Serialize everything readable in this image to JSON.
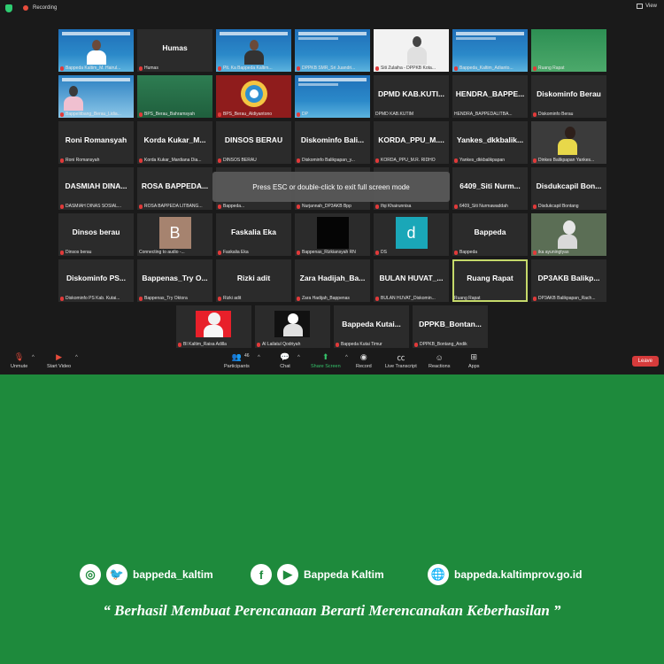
{
  "topbar": {
    "recording": "Recording",
    "view": "View"
  },
  "banner": "Press ESC or double-click to exit full screen mode",
  "tiles": [
    {
      "name": "",
      "cap": "Bappeda Kaltim_M. Hairul..."
    },
    {
      "name": "Humas",
      "cap": "Humas"
    },
    {
      "name": "",
      "cap": "Plt. Ka Bappeda Kaltim..."
    },
    {
      "name": "",
      "cap": "DPPKB SMR_Sri Juandri..."
    },
    {
      "name": "",
      "cap": "Siti Zulaiha - DPPKB Kota..."
    },
    {
      "name": "",
      "cap": "Bappeda_Kaltim_Adianto..."
    },
    {
      "name": "",
      "cap": "Ruang Rapat"
    },
    {
      "name": "",
      "cap": "Bappelitbang_Berau_Lidia..."
    },
    {
      "name": "",
      "cap": "BPS_Berau_Bahramsyah"
    },
    {
      "name": "",
      "cap": "BPS_Berau_Aldiyantono"
    },
    {
      "name": "",
      "cap": "DP"
    },
    {
      "name": "DPMD KAB.KUTI...",
      "cap": "DPMD KAB.KUTIM"
    },
    {
      "name": "HENDRA_BAPPE...",
      "cap": "HENDRA_BAPPEDALITBA..."
    },
    {
      "name": "Diskominfo Berau",
      "cap": "Diskominfo Berau"
    },
    {
      "name": "Roni Romansyah",
      "cap": "Roni Romansyah"
    },
    {
      "name": "Korda Kukar_M...",
      "cap": "Korda Kukar_Mardiana Dia..."
    },
    {
      "name": "DINSOS BERAU",
      "cap": "DINSOS BERAU"
    },
    {
      "name": "Diskominfo Bali...",
      "cap": "Diskominfo Balikpapan_y..."
    },
    {
      "name": "KORDA_PPU_M....",
      "cap": "KORDA_PPU_M.R. RIDHO"
    },
    {
      "name": "Yankes_dkkbalik...",
      "cap": "Yankes_dkkbalikpapan"
    },
    {
      "name": "",
      "cap": "Dinkes Balikpapan Yankes..."
    },
    {
      "name": "DASMIAH DINA...",
      "cap": "DASMIAH DINAS SOSIAL..."
    },
    {
      "name": "ROSA BAPPEDA...",
      "cap": "ROSA BAPPEDA LITBANG..."
    },
    {
      "name": "",
      "cap": "Bappeda..."
    },
    {
      "name": "",
      "cap": "Nurjannah_DP3AKB Bpp"
    },
    {
      "name": "",
      "cap": "Ifqi Khairunnisa"
    },
    {
      "name": "6409_Siti Nurm...",
      "cap": "6409_Siti Nurmawaddah"
    },
    {
      "name": "Disdukcapil Bon...",
      "cap": "Disdukcapil Bontang"
    },
    {
      "name": "Dinsos berau",
      "cap": "Dinsos berau"
    },
    {
      "name": "",
      "cap": "Connecting to audio -..."
    },
    {
      "name": "Faskalia Eka",
      "cap": "Faskalia Eka"
    },
    {
      "name": "",
      "cap": "Bappenas_Rizkiansyah RN"
    },
    {
      "name": "",
      "cap": "DS"
    },
    {
      "name": "Bappeda",
      "cap": "Bappeda"
    },
    {
      "name": "",
      "cap": "ika ayuningtyas"
    },
    {
      "name": "Diskominfo PS...",
      "cap": "Diskominfo PS Kab. Kutai..."
    },
    {
      "name": "Bappenas_Try O...",
      "cap": "Bappenas_Try Oktora"
    },
    {
      "name": "Rizki adit",
      "cap": "Rizki adit"
    },
    {
      "name": "Zara Hadijah_Ba...",
      "cap": "Zara Hadijah_Bappenas"
    },
    {
      "name": "BULAN HUVAT_...",
      "cap": "BULAN HUVAT_Diskomin..."
    },
    {
      "name": "Ruang Rapat",
      "cap": "Ruang Rapat"
    },
    {
      "name": "DP3AKB Balikp...",
      "cap": "DP3AKB Balikpapan_Rach..."
    },
    {
      "name": "",
      "cap": "BI Kaltim_Raisa Adilla"
    },
    {
      "name": "",
      "cap": "Al Lailatul Qodriyah"
    },
    {
      "name": "Bappeda Kutai...",
      "cap": "Bappeda Kutai Timur"
    },
    {
      "name": "DPPKB_Bontan...",
      "cap": "DPPKB_Bontang_Andik"
    }
  ],
  "avatars": {
    "b": "B",
    "d": "d"
  },
  "toolbar": {
    "unmute": "Unmute",
    "start_video": "Start Video",
    "participants": "Participants",
    "participants_count": "46",
    "chat": "Chat",
    "share": "Share Screen",
    "record": "Record",
    "transcript": "Live Transcript",
    "reactions": "Reactions",
    "apps": "Apps",
    "leave": "Leave"
  },
  "footer": {
    "twitter_handle": "bappeda_kaltim",
    "facebook_name": "Bappeda Kaltim",
    "website": "bappeda.kaltimprov.go.id",
    "quote": "“ Berhasil  Membuat Perencanaan Berarti Merencanakan Keberhasilan ”"
  },
  "colors": {
    "background": "#1e8a3c",
    "leave": "#d63b3b",
    "active_speaker": "#c5d96a"
  }
}
